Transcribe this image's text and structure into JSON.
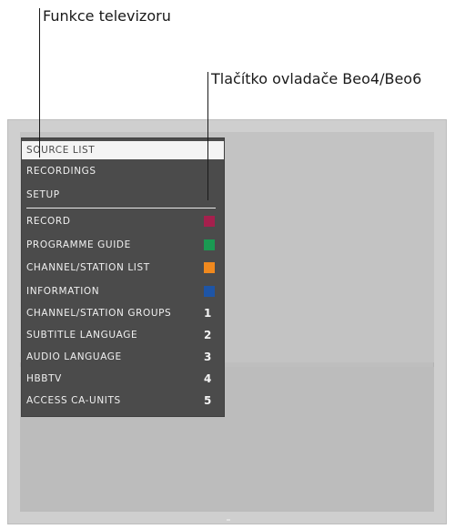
{
  "labels": {
    "tv_functions": "Funkce televizoru",
    "remote_button": "Tlačítko ovladače Beo4/Beo6"
  },
  "menu": {
    "items": [
      {
        "label": "SOURCE LIST"
      },
      {
        "label": "RECORDINGS"
      },
      {
        "label": "SETUP"
      },
      {
        "label": "RECORD",
        "key_color": "#a5204d",
        "key_name": "red-button"
      },
      {
        "label": "PROGRAMME GUIDE",
        "key_color": "#1a9a52",
        "key_name": "green-button"
      },
      {
        "label": "CHANNEL/STATION LIST",
        "key_color": "#f0891e",
        "key_name": "yellow-button"
      },
      {
        "label": "INFORMATION",
        "key_color": "#1e55a6",
        "key_name": "blue-button"
      },
      {
        "label": "CHANNEL/STATION GROUPS",
        "key": "1"
      },
      {
        "label": "SUBTITLE LANGUAGE",
        "key": "2"
      },
      {
        "label": "AUDIO LANGUAGE",
        "key": "3"
      },
      {
        "label": "HBBTV",
        "key": "4"
      },
      {
        "label": "ACCESS CA-UNITS",
        "key": "5"
      }
    ]
  },
  "colors": {
    "menu_background": "#4b4b4b",
    "selected_background": "#f4f4f4",
    "tv_frame": "#cfcfcf",
    "tv_screen": "#bebebe"
  }
}
